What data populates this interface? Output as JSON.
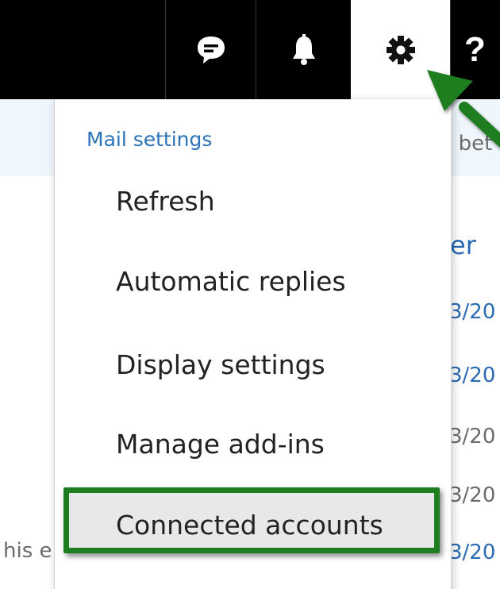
{
  "header": {
    "buttons": [
      {
        "name": "chat",
        "icon": "chat-bubble-icon"
      },
      {
        "name": "notifications",
        "icon": "bell-icon"
      },
      {
        "name": "settings",
        "icon": "gear-icon",
        "active": true
      },
      {
        "name": "help",
        "icon": "help-icon",
        "glyph": "?"
      }
    ]
  },
  "background": {
    "banner_text": "- bet",
    "column_heading": "er",
    "date_fragments": [
      "3/20",
      "3/20",
      "3/20",
      "3/20",
      "3/20"
    ],
    "left_fragment": "his e"
  },
  "settings_menu": {
    "header": "Mail settings",
    "items": [
      {
        "label": "Refresh"
      },
      {
        "label": "Automatic replies"
      },
      {
        "label": "Display settings"
      },
      {
        "label": "Manage add-ins"
      },
      {
        "label": "Connected accounts",
        "highlighted": true
      }
    ]
  },
  "colors": {
    "topbar": "#000000",
    "menu_header": "#2a73b8",
    "annotation_green": "#1e7d1e",
    "banner_bg": "#eff6fc"
  }
}
